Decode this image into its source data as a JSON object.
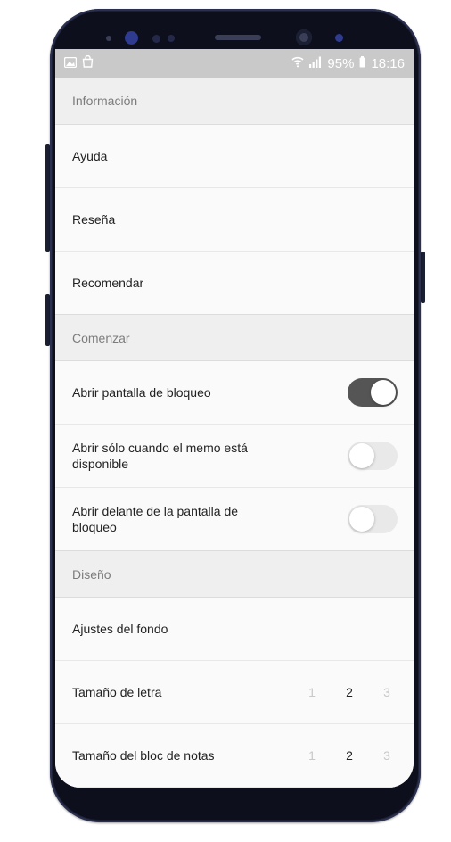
{
  "status_bar": {
    "battery": "95%",
    "time": "18:16",
    "icons": [
      "gallery-icon",
      "bag-icon",
      "wifi-icon",
      "signal-icon"
    ]
  },
  "sections": {
    "info": {
      "title": "Información",
      "items": [
        "Ayuda",
        "Reseña",
        "Recomendar"
      ]
    },
    "start": {
      "title": "Comenzar",
      "items": [
        {
          "label": "Abrir pantalla de bloqueo",
          "toggle": true
        },
        {
          "label": "Abrir sólo cuando el memo está disponible",
          "toggle": false
        },
        {
          "label": "Abrir delante de la pantalla de bloqueo",
          "toggle": false
        }
      ]
    },
    "design": {
      "title": "Diseño",
      "items": {
        "background": "Ajustes del fondo",
        "font_size": {
          "label": "Tamaño de letra",
          "options": [
            "1",
            "2",
            "3"
          ],
          "selected": "2"
        },
        "pad_size": {
          "label": "Tamaño del bloc de notas",
          "options": [
            "1",
            "2",
            "3"
          ],
          "selected": "2"
        }
      }
    }
  },
  "colors": {
    "toggle_on": "#555555",
    "toggle_off": "#e9e9e9"
  }
}
